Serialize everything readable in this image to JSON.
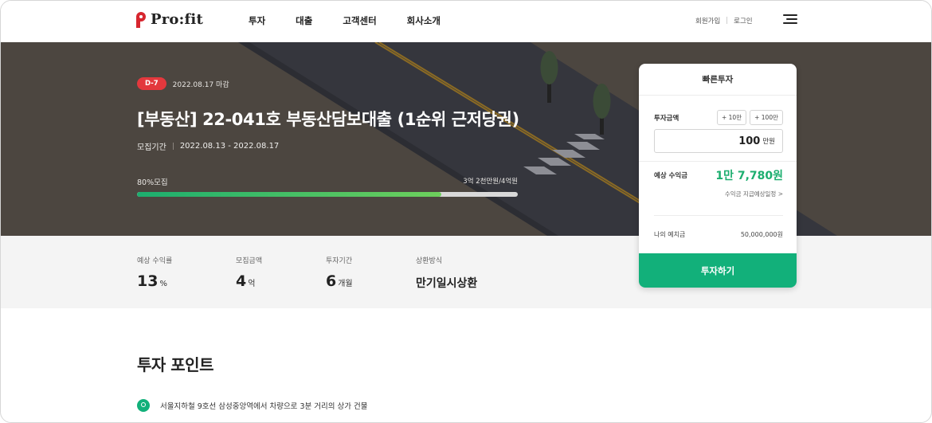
{
  "header": {
    "logo_text": "Pro:fit",
    "nav": [
      "투자",
      "대출",
      "고객센터",
      "회사소개"
    ],
    "signup": "회원가입",
    "login": "로그인",
    "divider": "|"
  },
  "hero": {
    "dday": "D-7",
    "deadline": "2022.08.17 마감",
    "title": "[부동산] 22-041호 부동산담보대출 (1순위 근저당권)",
    "period_label": "모집기간",
    "period_value": "2022.08.13 - 2022.08.17",
    "progress_label": "80%모집",
    "progress_amount": "3억 2천만원/4억원",
    "progress_fraction": 0.8
  },
  "stats": [
    {
      "label": "예상 수익률",
      "value": "13",
      "unit": "%"
    },
    {
      "label": "모집금액",
      "value": "4",
      "unit": "억"
    },
    {
      "label": "투자기간",
      "value": "6",
      "unit": "개월"
    },
    {
      "label": "상환방식",
      "value": "만기일시상환",
      "unit": ""
    }
  ],
  "card": {
    "title": "빠른투자",
    "amount_label": "투자금액",
    "chip_10": "+ 10만",
    "chip_100": "+ 100만",
    "amount_value": "100",
    "amount_unit": "만원",
    "expected_label": "예상 수익금",
    "expected_value": "1만 7,780원",
    "schedule_link": "수익금 지급예상일정 >",
    "deposit_label": "나의 예치금",
    "deposit_value": "50,000,000원",
    "invest_button": "투자하기"
  },
  "points": {
    "title": "투자 포인트",
    "items": [
      "서울지하철 9호선 삼성중앙역에서 차량으로 3분 거리의 상가 건물"
    ]
  },
  "colors": {
    "accent_green": "#12b07a",
    "dday_red": "#e3383d",
    "logo_red": "#d7262f",
    "hero_bg": "#4c4640"
  }
}
